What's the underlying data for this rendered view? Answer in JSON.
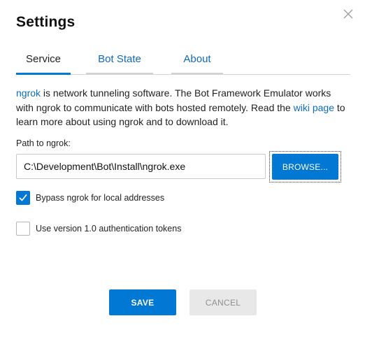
{
  "dialog": {
    "title": "Settings",
    "close_icon": "close-icon"
  },
  "tabs": [
    {
      "label": "Service",
      "active": true
    },
    {
      "label": "Bot State",
      "active": false
    },
    {
      "label": "About",
      "active": false
    }
  ],
  "service": {
    "description": {
      "link1": "ngrok",
      "text1": " is network tunneling software. The Bot Framework Emulator works with ngrok to communicate with bots hosted remotely. Read the ",
      "link2": "wiki page",
      "text2": " to learn more about using ngrok and to download it."
    },
    "path_label": "Path to ngrok:",
    "path_value": "C:\\Development\\Bot\\Install\\ngrok.exe",
    "browse_label": "BROWSE...",
    "bypass_label": "Bypass ngrok for local addresses",
    "bypass_checked": true,
    "v1_auth_label": "Use version 1.0 authentication tokens",
    "v1_auth_checked": false
  },
  "footer": {
    "save_label": "SAVE",
    "cancel_label": "CANCEL"
  },
  "colors": {
    "accent": "#0078d4",
    "link": "#0f6cbd",
    "disabled_bg": "#e8e8e8",
    "disabled_text": "#8f8f8f"
  }
}
